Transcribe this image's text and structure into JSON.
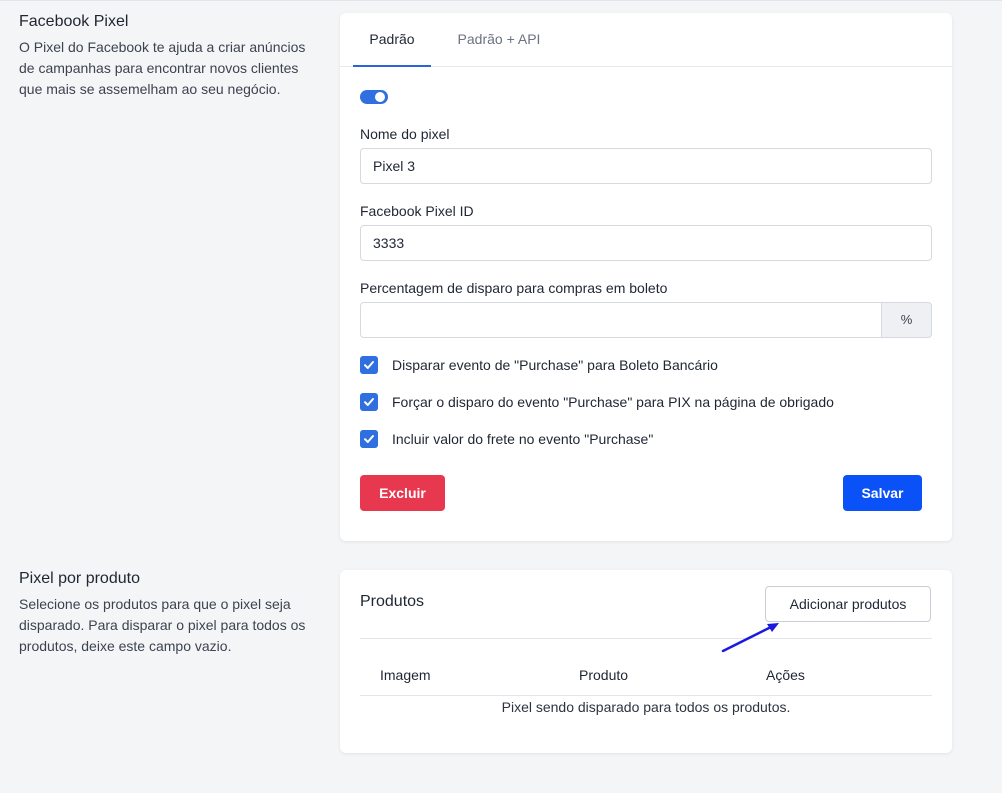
{
  "pixel_section": {
    "title": "Facebook Pixel",
    "description": "O Pixel do Facebook te ajuda a criar anúncios de campanhas para encontrar novos clientes que mais se assemelham ao seu negócio.",
    "tabs": [
      {
        "label": "Padrão",
        "active": true
      },
      {
        "label": "Padrão + API",
        "active": false
      }
    ],
    "toggle_on": true,
    "fields": {
      "pixel_name_label": "Nome do pixel",
      "pixel_name_value": "Pixel 3",
      "pixel_id_label": "Facebook Pixel ID",
      "pixel_id_value": "3333",
      "boleto_pct_label": "Percentagem de disparo para compras em boleto",
      "boleto_pct_value": "",
      "boleto_pct_addon": "%"
    },
    "checkboxes": [
      {
        "label": "Disparar evento de \"Purchase\" para Boleto Bancário",
        "checked": true
      },
      {
        "label": "Forçar o disparo do evento \"Purchase\" para PIX na página de obrigado",
        "checked": true
      },
      {
        "label": "Incluir valor do frete no evento \"Purchase\"",
        "checked": true
      }
    ],
    "delete_button": "Excluir",
    "save_button": "Salvar"
  },
  "product_section": {
    "title": "Pixel por produto",
    "description": "Selecione os produtos para que o pixel seja disparado. Para disparar o pixel para todos os produtos, deixe este campo vazio.",
    "card_title": "Produtos",
    "add_button": "Adicionar produtos",
    "table_headers": [
      "Imagem",
      "Produto",
      "Ações"
    ],
    "empty_message": "Pixel sendo disparado para todos os produtos."
  },
  "colors": {
    "primary": "#0a52f7",
    "danger": "#e8384f",
    "toggle": "#2f6fdf",
    "annotation_arrow": "#1a1adf"
  }
}
